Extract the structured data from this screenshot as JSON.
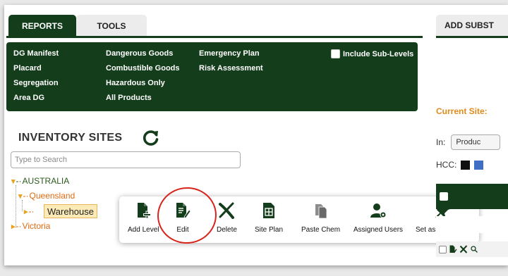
{
  "tabs": {
    "reports": "REPORTS",
    "tools": "TOOLS"
  },
  "reports_menu": {
    "col1": [
      "DG Manifest",
      "Placard",
      "Segregation",
      "Area DG"
    ],
    "col2": [
      "Dangerous Goods",
      "Combustible Goods",
      "Hazardous Only",
      "All Products"
    ],
    "col3": [
      "Emergency Plan",
      "Risk Assessment"
    ],
    "include_sublevels": "Include Sub-Levels"
  },
  "inventory": {
    "title": "INVENTORY SITES",
    "search_placeholder": "Type to Search",
    "tree": {
      "australia": "AUSTRALIA",
      "queensland": "Queensland",
      "warehouse": "Warehouse",
      "victoria": "Victoria"
    }
  },
  "actions": {
    "add_level": "Add Level",
    "edit": "Edit",
    "delete": "Delete",
    "site_plan": "Site Plan",
    "paste_chem": "Paste Chem",
    "assigned_users": "Assigned Users",
    "favourite": "Set as a favourite"
  },
  "right_panel": {
    "tab": "ADD SUBST",
    "current_site": "Current Site:",
    "in_label": "In:",
    "in_value": "Produc",
    "hcc_label": "HCC:"
  },
  "colors": {
    "dark_green": "#143d1c",
    "orange": "#e06a10",
    "highlight_red": "#d9241c",
    "hcc_black": "#111111",
    "hcc_blue": "#3f6fc4"
  }
}
